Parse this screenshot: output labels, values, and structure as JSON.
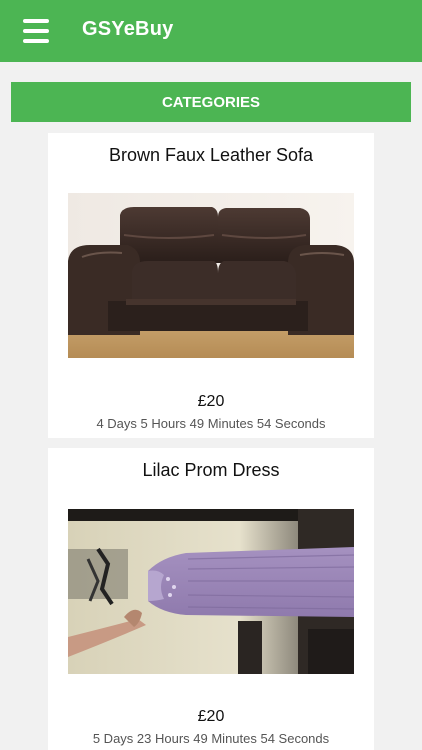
{
  "app": {
    "title": "GSYeBuy",
    "menu_icon": "hamburger-menu-icon",
    "brand_color": "#4cb553"
  },
  "categories_button": {
    "label": "CATEGORIES"
  },
  "listings": [
    {
      "title": "Brown Faux Leather Sofa",
      "price": "£20",
      "time_left": "4 Days 5 Hours 49 Minutes 54 Seconds",
      "image": "brown-leather-sofa-photo"
    },
    {
      "title": "Lilac Prom Dress",
      "price": "£20",
      "time_left": "5 Days 23 Hours 49 Minutes 54 Seconds",
      "image": "lilac-prom-dress-photo"
    }
  ]
}
